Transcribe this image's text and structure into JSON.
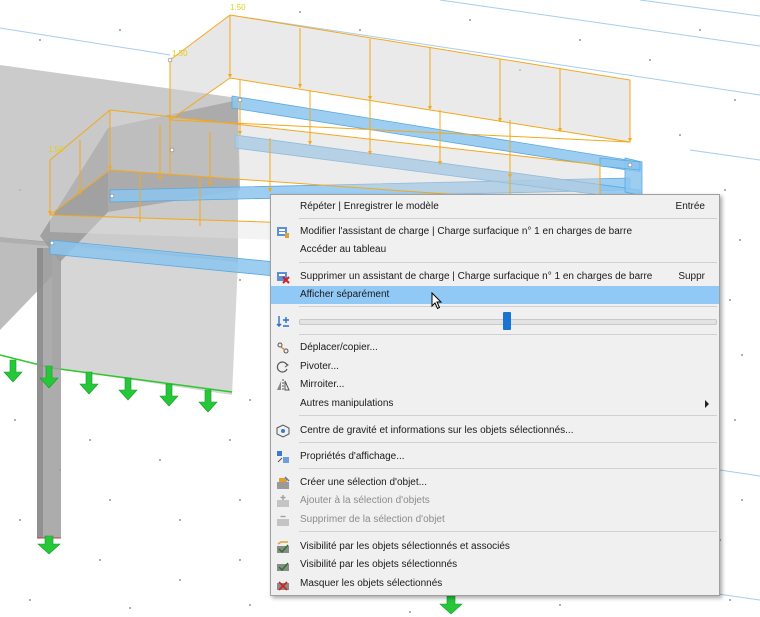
{
  "viewport": {
    "dim_labels": [
      "1.50",
      "1.50",
      "1.50"
    ]
  },
  "context_menu": {
    "items": [
      {
        "label": "Répéter | Enregistrer le modèle",
        "shortcut": "Entrée",
        "icon": "none"
      },
      {
        "label": "Modifier l'assistant de charge | Charge surfacique n° 1 en charges de barre",
        "icon": "edit-load-wizard-icon"
      },
      {
        "label": "Accéder au tableau",
        "icon": "none"
      },
      {
        "label": "Supprimer un assistant de charge | Charge surfacique n° 1 en charges de barre",
        "shortcut": "Suppr",
        "icon": "delete-load-wizard-icon"
      },
      {
        "label": "Afficher séparément",
        "icon": "none",
        "highlighted": true
      },
      {
        "label": "Déplacer/copier...",
        "icon": "move-copy-icon"
      },
      {
        "label": "Pivoter...",
        "icon": "rotate-icon"
      },
      {
        "label": "Mirroiter...",
        "icon": "mirror-icon"
      },
      {
        "label": "Autres manipulations",
        "icon": "none",
        "submenu": true
      },
      {
        "label": "Centre de gravité et informations sur les objets sélectionnés...",
        "icon": "center-of-gravity-icon"
      },
      {
        "label": "Propriétés d'affichage...",
        "icon": "display-properties-icon"
      },
      {
        "label": "Créer une sélection d'objet...",
        "icon": "create-selection-icon"
      },
      {
        "label": "Ajouter à la sélection d'objets",
        "icon": "add-to-selection-icon",
        "disabled": true
      },
      {
        "label": "Supprimer de la sélection d'objet",
        "icon": "remove-from-selection-icon",
        "disabled": true
      },
      {
        "label": "Visibilité par les objets sélectionnés et associés",
        "icon": "visibility-associated-icon"
      },
      {
        "label": "Visibilité par les objets sélectionnés",
        "icon": "visibility-selected-icon"
      },
      {
        "label": "Masquer les objets sélectionnés",
        "icon": "hide-selected-icon"
      }
    ],
    "transparency_slider": {
      "icon": "transparency-icon",
      "value": 0.5
    }
  },
  "colors": {
    "highlight": "#90c8f6",
    "load_outline": "#f4a81a",
    "beam_blue": "#8cc6f0",
    "support_green": "#26c83a",
    "slider_thumb": "#1874d0"
  }
}
